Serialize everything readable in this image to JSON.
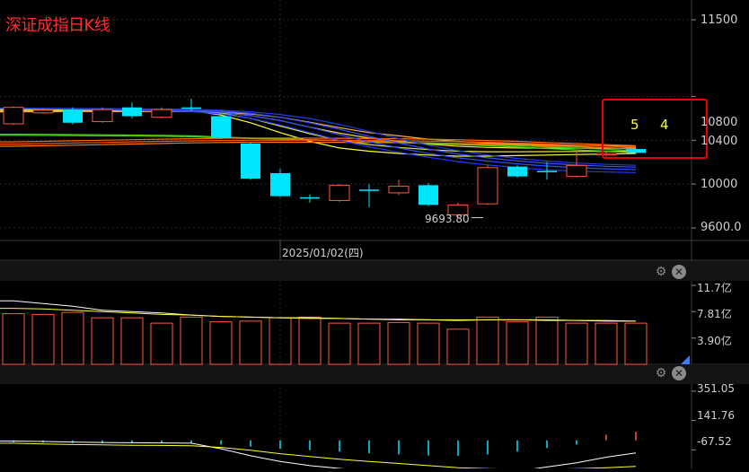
{
  "title": "深证成指日K线",
  "date_label": "2025/01/02(四)",
  "annotation": {
    "left": "5",
    "right": "4",
    "color": "#ffff33",
    "box_color": "#e60000"
  },
  "colors": {
    "up": "#ff5a3c",
    "down": "#00e5ff",
    "ma_yellow": "#ffff33",
    "ma_orange": "#ff6a00",
    "ma_green": "#4cd80e",
    "ma_blue": "#1f3cff"
  },
  "volume_axis": [
    "11.7亿",
    "7.81亿",
    "3.90亿"
  ],
  "macd_axis": [
    "351.05",
    "141.76",
    "-67.52"
  ],
  "chart_data": {
    "type": "candlestick",
    "title": "深证成指日K线",
    "ylim": [
      9450,
      11650
    ],
    "yticks": [
      11500,
      10800,
      10400,
      10000,
      9600
    ],
    "ytick_labels": [
      "11500",
      "10800",
      "10400",
      "10000",
      "9600.0"
    ],
    "x": [
      "2025/01/02"
    ],
    "low_marker": {
      "value": 9693.8,
      "label": "9693.80"
    },
    "candles": [
      {
        "o": 10550,
        "c": 10700,
        "h": 10710,
        "l": 10540
      },
      {
        "o": 10650,
        "c": 10675,
        "h": 10690,
        "l": 10640
      },
      {
        "o": 10680,
        "c": 10560,
        "h": 10700,
        "l": 10545
      },
      {
        "o": 10570,
        "c": 10680,
        "h": 10700,
        "l": 10560
      },
      {
        "o": 10700,
        "c": 10620,
        "h": 10745,
        "l": 10600
      },
      {
        "o": 10610,
        "c": 10680,
        "h": 10700,
        "l": 10600
      },
      {
        "o": 10700,
        "c": 10690,
        "h": 10780,
        "l": 10670
      },
      {
        "o": 10620,
        "c": 10420,
        "h": 10640,
        "l": 10410
      },
      {
        "o": 10370,
        "c": 10050,
        "h": 10380,
        "l": 10040
      },
      {
        "o": 10100,
        "c": 9890,
        "h": 10140,
        "l": 9880
      },
      {
        "o": 9880,
        "c": 9870,
        "h": 9905,
        "l": 9830
      },
      {
        "o": 9850,
        "c": 9990,
        "h": 10000,
        "l": 9840
      },
      {
        "o": 9950,
        "c": 9940,
        "h": 10000,
        "l": 9790
      },
      {
        "o": 9920,
        "c": 9980,
        "h": 10040,
        "l": 9900
      },
      {
        "o": 9990,
        "c": 9810,
        "h": 10010,
        "l": 9800
      },
      {
        "o": 9720,
        "c": 9810,
        "h": 9830,
        "l": 9693.8
      },
      {
        "o": 9820,
        "c": 10150,
        "h": 10170,
        "l": 9810
      },
      {
        "o": 10160,
        "c": 10070,
        "h": 10170,
        "l": 10060
      },
      {
        "o": 10120,
        "c": 10110,
        "h": 10200,
        "l": 10040
      },
      {
        "o": 10070,
        "c": 10170,
        "h": 10290,
        "l": 10060
      },
      {
        "o": 10270,
        "c": 10280,
        "h": 10300,
        "l": 10250
      },
      {
        "o": 10320,
        "c": 10285,
        "h": 10325,
        "l": 10275
      }
    ],
    "ma_lines": [
      {
        "color": "#ffff33",
        "values": [
          10690,
          10688,
          10685,
          10682,
          10679,
          10676,
          10670,
          10630,
          10560,
          10470,
          10390,
          10330,
          10300,
          10280,
          10265,
          10255,
          10255,
          10260,
          10265,
          10270,
          10275,
          10280
        ]
      },
      {
        "color": "#e8e84a",
        "values": [
          10680,
          10680,
          10678,
          10676,
          10674,
          10672,
          10668,
          10645,
          10600,
          10530,
          10460,
          10400,
          10360,
          10335,
          10315,
          10300,
          10295,
          10295,
          10296,
          10298,
          10300,
          10303
        ]
      },
      {
        "color": "#ffd84a",
        "values": [
          10670,
          10671,
          10671,
          10670,
          10669,
          10668,
          10666,
          10652,
          10625,
          10580,
          10520,
          10465,
          10420,
          10390,
          10365,
          10345,
          10335,
          10330,
          10328,
          10327,
          10327,
          10328
        ]
      },
      {
        "color": "#ffb04a",
        "values": [
          10660,
          10661,
          10662,
          10662,
          10662,
          10662,
          10661,
          10655,
          10640,
          10610,
          10565,
          10515,
          10470,
          10440,
          10410,
          10390,
          10375,
          10365,
          10358,
          10353,
          10350,
          10348
        ]
      },
      {
        "color": "#4cd80e",
        "values": [
          10455,
          10454,
          10452,
          10450,
          10448,
          10445,
          10440,
          10430,
          10420,
          10412,
          10405,
          10398,
          10390,
          10380,
          10370,
          10360,
          10350,
          10338,
          10325,
          10312,
          10300,
          10288
        ]
      },
      {
        "color": "#3ecc14",
        "values": [
          10445,
          10444,
          10442,
          10440,
          10438,
          10436,
          10432,
          10424,
          10416,
          10410,
          10404,
          10398,
          10392,
          10384,
          10376,
          10368,
          10360,
          10350,
          10340,
          10330,
          10318,
          10306
        ]
      },
      {
        "color": "#ff6a00",
        "values": [
          10385,
          10390,
          10395,
          10400,
          10405,
          10410,
          10414,
          10418,
          10420,
          10420,
          10419,
          10418,
          10416,
          10414,
          10410,
          10405,
          10398,
          10390,
          10380,
          10370,
          10360,
          10350
        ]
      },
      {
        "color": "#ff5500",
        "values": [
          10365,
          10370,
          10375,
          10380,
          10385,
          10390,
          10394,
          10398,
          10400,
          10400,
          10400,
          10399,
          10398,
          10396,
          10392,
          10388,
          10382,
          10374,
          10366,
          10356,
          10346,
          10336
        ]
      },
      {
        "color": "#ff7a10",
        "values": [
          10345,
          10350,
          10355,
          10360,
          10366,
          10371,
          10376,
          10380,
          10382,
          10382,
          10382,
          10381,
          10380,
          10378,
          10375,
          10371,
          10365,
          10358,
          10350,
          10342,
          10332,
          10322
        ]
      },
      {
        "color": "#1f3cff",
        "values": [
          10690,
          10688,
          10684,
          10679,
          10673,
          10668,
          10662,
          10640,
          10600,
          10540,
          10470,
          10400,
          10340,
          10290,
          10245,
          10205,
          10175,
          10150,
          10130,
          10118,
          10110,
          10105
        ]
      },
      {
        "color": "#2a4cff",
        "values": [
          10690,
          10689,
          10687,
          10684,
          10680,
          10676,
          10671,
          10655,
          10625,
          10580,
          10520,
          10450,
          10385,
          10330,
          10280,
          10240,
          10210,
          10185,
          10165,
          10150,
          10140,
          10132
        ]
      },
      {
        "color": "#3355ff",
        "values": [
          10690,
          10690,
          10689,
          10687,
          10684,
          10681,
          10677,
          10666,
          10645,
          10610,
          10560,
          10500,
          10435,
          10375,
          10320,
          10275,
          10240,
          10212,
          10190,
          10175,
          10163,
          10155
        ]
      },
      {
        "color": "#223dd8",
        "values": [
          10690,
          10690,
          10690,
          10689,
          10687,
          10685,
          10682,
          10674,
          10660,
          10635,
          10598,
          10545,
          10480,
          10415,
          10355,
          10305,
          10265,
          10235,
          10210,
          10192,
          10180,
          10172
        ]
      }
    ],
    "volume": {
      "ylim": [
        0,
        12.5
      ],
      "yticks": [
        11.7,
        7.81,
        3.9
      ],
      "values": [
        7.5,
        7.4,
        7.7,
        6.9,
        6.9,
        6.1,
        7.0,
        6.3,
        6.4,
        6.9,
        7.0,
        6.1,
        6.1,
        6.2,
        6.1,
        5.2,
        7.0,
        6.3,
        7.0,
        6.1,
        6.1,
        6.1
      ],
      "ma": [
        {
          "color": "#ffffff",
          "values": [
            9.4,
            9.0,
            8.6,
            8.0,
            7.8,
            7.6,
            7.3,
            7.1,
            7.0,
            6.9,
            6.9,
            6.8,
            6.7,
            6.6,
            6.6,
            6.5,
            6.6,
            6.6,
            6.6,
            6.5,
            6.4,
            6.4
          ]
        },
        {
          "color": "#ffff33",
          "values": [
            8.3,
            8.2,
            8.0,
            7.8,
            7.6,
            7.4,
            7.3,
            7.1,
            7.0,
            6.9,
            6.8,
            6.8,
            6.7,
            6.7,
            6.6,
            6.6,
            6.6,
            6.6,
            6.5,
            6.5,
            6.5,
            6.4
          ]
        }
      ]
    },
    "macd": {
      "ylim": [
        -200,
        440
      ],
      "yticks": [
        351.05,
        141.76,
        -67.52
      ],
      "bars": [
        -14,
        -16,
        -19,
        -20,
        -20,
        -19,
        -21,
        -30,
        -45,
        -60,
        -70,
        -80,
        -92,
        -100,
        -108,
        -110,
        -100,
        -80,
        -55,
        -30,
        40,
        60
      ],
      "lines": [
        {
          "color": "#ffffff",
          "values": [
            -5,
            -8,
            -12,
            -15,
            -17,
            -18,
            -20,
            -60,
            -110,
            -150,
            -180,
            -200,
            -220,
            -240,
            -255,
            -260,
            -245,
            -220,
            -190,
            -160,
            -120,
            -90
          ]
        },
        {
          "color": "#ffff33",
          "values": [
            -20,
            -25,
            -30,
            -32,
            -35,
            -36,
            -38,
            -50,
            -70,
            -95,
            -115,
            -135,
            -150,
            -165,
            -180,
            -195,
            -202,
            -205,
            -205,
            -202,
            -195,
            -185
          ]
        }
      ]
    }
  }
}
